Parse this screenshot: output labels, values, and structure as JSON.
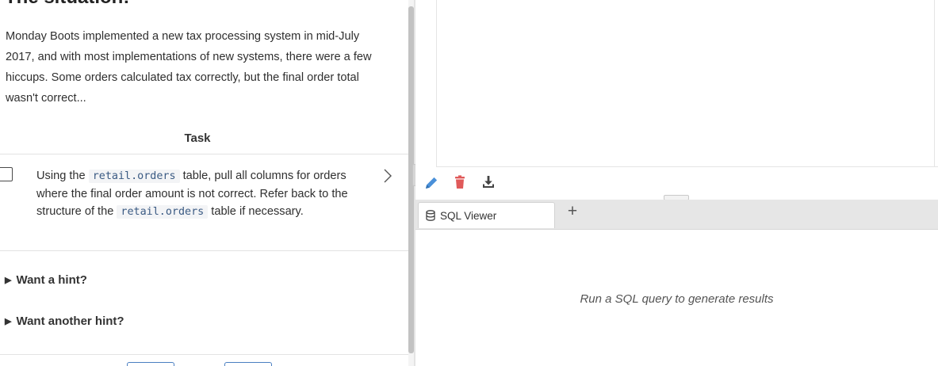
{
  "lesson": {
    "heading": "The situation:",
    "intro": "Monday Boots implemented a new tax processing system in mid-July 2017, and with most implementations of new systems, there were a few hiccups. Some orders calculated tax correctly, but the final order total wasn't correct...",
    "task_title": "Task",
    "task": {
      "text_1": "Using the ",
      "code_1": "retail.orders",
      "text_2": " table, pull all columns for orders where the final order amount is not correct. Refer back to the structure of the ",
      "code_2": "retail.orders",
      "text_3": " table if necessary."
    },
    "hints": [
      "Want a hint?",
      "Want another hint?"
    ]
  },
  "toolbar": {
    "icons": [
      "pencil-icon",
      "trash-icon",
      "download-icon"
    ],
    "edit_color": "#4a90d9",
    "trash_color": "#e05a5a",
    "download_color": "#444444"
  },
  "tabs": {
    "active": "SQL Viewer",
    "add_label": "+"
  },
  "results": {
    "empty_message": "Run a SQL query to generate results"
  }
}
